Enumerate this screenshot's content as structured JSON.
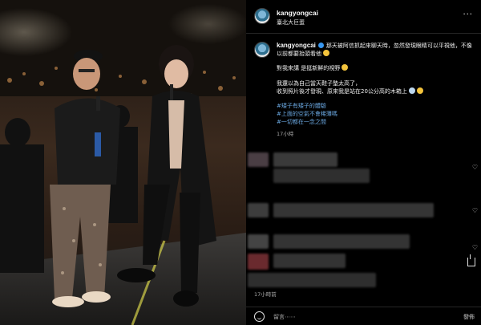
{
  "post": {
    "username": "kangyongcai",
    "location": "臺北大巨蛋",
    "caption": {
      "line1": "那天被阿信抓起來聊天時，忽然發現眼睛可以平視他，不像以前都要抬頭看他",
      "line2": "對我來講 是挺新鮮的視野",
      "line3a": "我還以為自己當天鞋子墊太高了，",
      "line3b": "收到照片後才發現、原來我是站在20公分高的木箱上"
    },
    "hashtags": [
      "#矮子有矮子的體驗",
      "#上面的空氣不會稀薄嗎",
      "#一切都在一念之間"
    ],
    "caption_time": "17小時",
    "post_time": "17小時前"
  },
  "comment_box": {
    "placeholder": "留言⋯⋯",
    "post_label": "發佈"
  },
  "icons": {
    "more": "more-options-icon",
    "like": "heart-icon",
    "emoji": "emoji-icon",
    "share": "share-icon"
  },
  "colors": {
    "background": "#000000",
    "hashtag": "#6aa7e0",
    "verified": "#3897f0",
    "muted": "#a8a8a8"
  }
}
